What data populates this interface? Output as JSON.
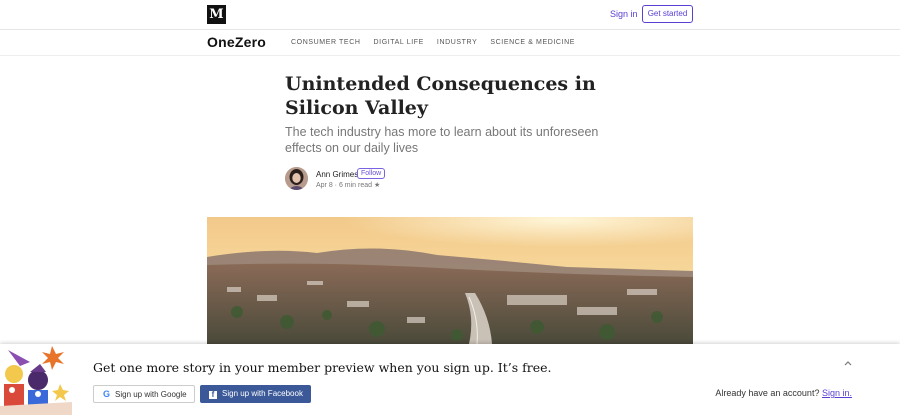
{
  "topbar": {
    "logo": "M",
    "sign_in": "Sign in",
    "get_started": "Get started"
  },
  "publication": {
    "brand": "OneZero",
    "nav": [
      "CONSUMER TECH",
      "DIGITAL LIFE",
      "INDUSTRY",
      "SCIENCE & MEDICINE"
    ]
  },
  "article": {
    "title_line1": "Unintended Consequences in",
    "title_line2": "Silicon Valley",
    "subtitle": "The tech industry has more to learn about its unforeseen effects on our daily lives",
    "author": "Ann Grimes",
    "follow": "Follow",
    "meta": "Apr 8 · 6 min read ★"
  },
  "banner": {
    "message": "Get one more story in your member preview when you sign up. It’s free.",
    "google_label": "Sign up with Google",
    "google_icon": "G",
    "facebook_label": "Sign up with Facebook",
    "facebook_icon": "f",
    "already_text": "Already have an account?",
    "sign_in_link": "Sign in.",
    "collapse_icon": "chevron-up-icon"
  },
  "colors": {
    "accent": "#5a3fd2",
    "facebook": "#3b5998"
  }
}
